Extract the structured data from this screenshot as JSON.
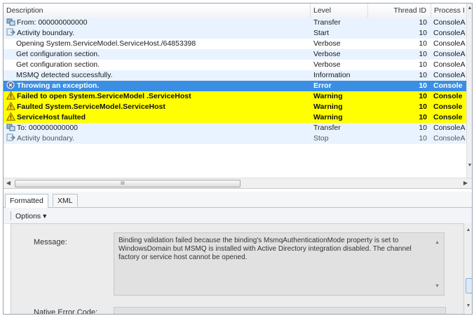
{
  "columns": {
    "description": "Description",
    "level": "Level",
    "thread_id": "Thread ID",
    "process": "Process I"
  },
  "rows": [
    {
      "description": "From: 000000000000",
      "level": "Transfer",
      "thread_id": "10",
      "process": "ConsoleA",
      "icon": "transfer-icon"
    },
    {
      "description": "Activity boundary.",
      "level": "Start",
      "thread_id": "10",
      "process": "ConsoleA",
      "icon": "activity-icon"
    },
    {
      "description": "Opening System.ServiceModel.ServiceHost./64853398",
      "level": "Verbose",
      "thread_id": "10",
      "process": "ConsoleA",
      "icon": ""
    },
    {
      "description": "Get configuration section.",
      "level": "Verbose",
      "thread_id": "10",
      "process": "ConsoleA",
      "icon": ""
    },
    {
      "description": "Get configuration section.",
      "level": "Verbose",
      "thread_id": "10",
      "process": "ConsoleA",
      "icon": ""
    },
    {
      "description": "MSMQ detected successfully.",
      "level": "Information",
      "thread_id": "10",
      "process": "ConsoleA",
      "icon": ""
    },
    {
      "description": "Throwing an exception.",
      "level": "Error",
      "thread_id": "10",
      "process": "Console",
      "icon": "error-icon"
    },
    {
      "description": "Failed to open System.ServiceModel .ServiceHost",
      "level": "Warning",
      "thread_id": "10",
      "process": "Console",
      "icon": "warning-icon"
    },
    {
      "description": "Faulted System.ServiceModel.ServiceHost",
      "level": "Warning",
      "thread_id": "10",
      "process": "Console",
      "icon": "warning-icon"
    },
    {
      "description": "ServiceHost faulted",
      "level": "Warning",
      "thread_id": "10",
      "process": "Console",
      "icon": "warning-icon"
    },
    {
      "description": "To: 000000000000",
      "level": "Transfer",
      "thread_id": "10",
      "process": "ConsoleA",
      "icon": "transfer-icon"
    },
    {
      "description": "Activity boundary.",
      "level": "Stop",
      "thread_id": "10",
      "process": "ConsoleA",
      "icon": "activity-icon"
    }
  ],
  "hscroll_grip": "III",
  "tabs": [
    "Formatted",
    "XML"
  ],
  "toolbar": {
    "options_label": "Options",
    "options_arrow": "▾"
  },
  "detail": {
    "message_label": "Message:",
    "message_text": "Binding validation failed because the binding's MsmqAuthenticationMode property is set to WindowsDomain but MSMQ is installed with Active Directory integration disabled. The channel factory or service host cannot be opened.",
    "native_error_label": "Native Error Code:"
  },
  "colors": {
    "selected_row": "#3a8fe2",
    "warning_row": "#ffff00",
    "info_row": "#e9f3ff"
  }
}
